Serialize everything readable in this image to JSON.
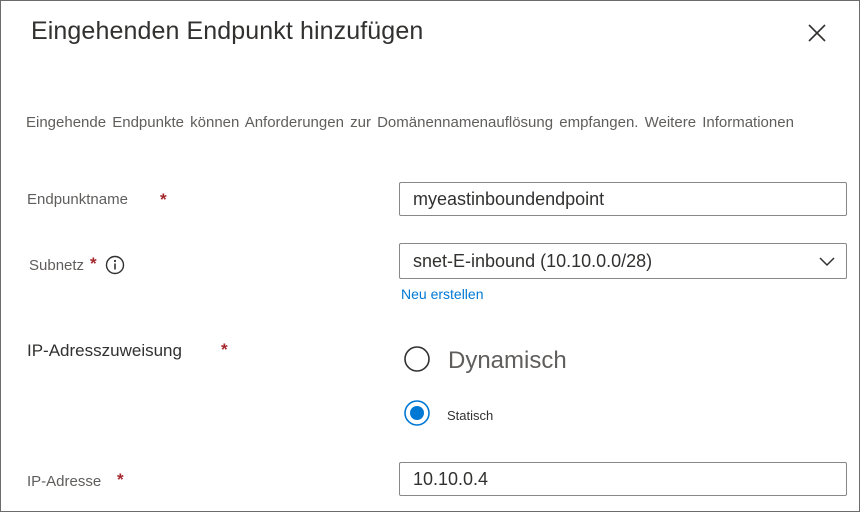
{
  "dialog": {
    "title": "Eingehenden Endpunkt hinzufügen",
    "description": "Eingehende Endpunkte können Anforderungen zur Domänennamenauflösung empfangen. Weitere Informationen"
  },
  "form": {
    "endpoint_name": {
      "label": "Endpunktname",
      "required": "*",
      "value": "myeastinboundendpoint"
    },
    "subnet": {
      "label": "Subnetz",
      "required": "*",
      "selected": "snet-E-inbound (10.10.0.0/28)",
      "create_new": "Neu erstellen"
    },
    "ip_assignment": {
      "label": "IP-Adresszuweisung",
      "required": "*",
      "options": [
        {
          "label": "Dynamisch",
          "checked": false
        },
        {
          "label": "Statisch",
          "checked": true
        }
      ]
    },
    "ip_address": {
      "label": "IP-Adresse",
      "required": "*",
      "value": "10.10.0.4"
    }
  },
  "colors": {
    "accent": "#0078d4",
    "required": "#a4262c",
    "border": "#8a8886"
  },
  "icons": {
    "close": "close-icon",
    "info": "info-icon",
    "chevron": "chevron-down-icon"
  }
}
